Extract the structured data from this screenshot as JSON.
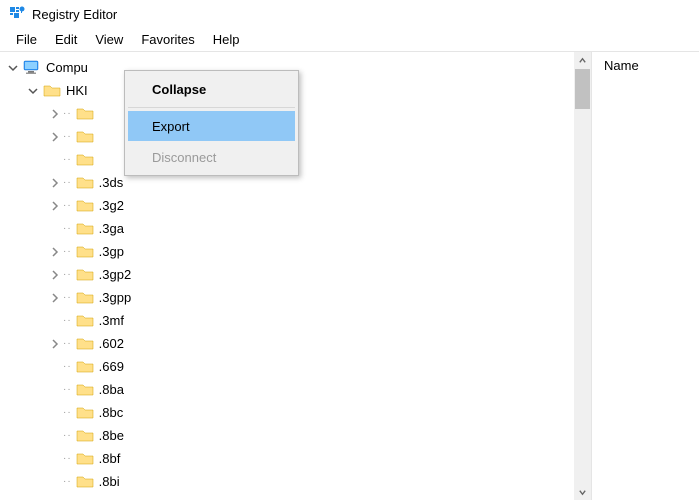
{
  "window": {
    "title": "Registry Editor"
  },
  "menubar": {
    "items": [
      "File",
      "Edit",
      "View",
      "Favorites",
      "Help"
    ]
  },
  "tree": {
    "root": {
      "label": "Compu",
      "expanded": true
    },
    "hkey": {
      "label": "HKI",
      "expanded": true
    },
    "items": [
      {
        "label": "",
        "arrow": ">"
      },
      {
        "label": "",
        "arrow": ">"
      },
      {
        "label": "",
        "arrow": ""
      },
      {
        "label": ".3ds",
        "arrow": ">"
      },
      {
        "label": ".3g2",
        "arrow": ">"
      },
      {
        "label": ".3ga",
        "arrow": ""
      },
      {
        "label": ".3gp",
        "arrow": ">"
      },
      {
        "label": ".3gp2",
        "arrow": ">"
      },
      {
        "label": ".3gpp",
        "arrow": ">"
      },
      {
        "label": ".3mf",
        "arrow": ""
      },
      {
        "label": ".602",
        "arrow": ">"
      },
      {
        "label": ".669",
        "arrow": ""
      },
      {
        "label": ".8ba",
        "arrow": ""
      },
      {
        "label": ".8bc",
        "arrow": ""
      },
      {
        "label": ".8be",
        "arrow": ""
      },
      {
        "label": ".8bf",
        "arrow": ""
      },
      {
        "label": ".8bi",
        "arrow": ""
      }
    ]
  },
  "list": {
    "header": "Name"
  },
  "context_menu": {
    "items": [
      {
        "label": "Collapse",
        "bold": true,
        "hover": false,
        "disabled": false
      },
      {
        "sep": true
      },
      {
        "label": "Export",
        "bold": false,
        "hover": true,
        "disabled": false
      },
      {
        "label": "Disconnect",
        "bold": false,
        "hover": false,
        "disabled": true
      }
    ]
  }
}
